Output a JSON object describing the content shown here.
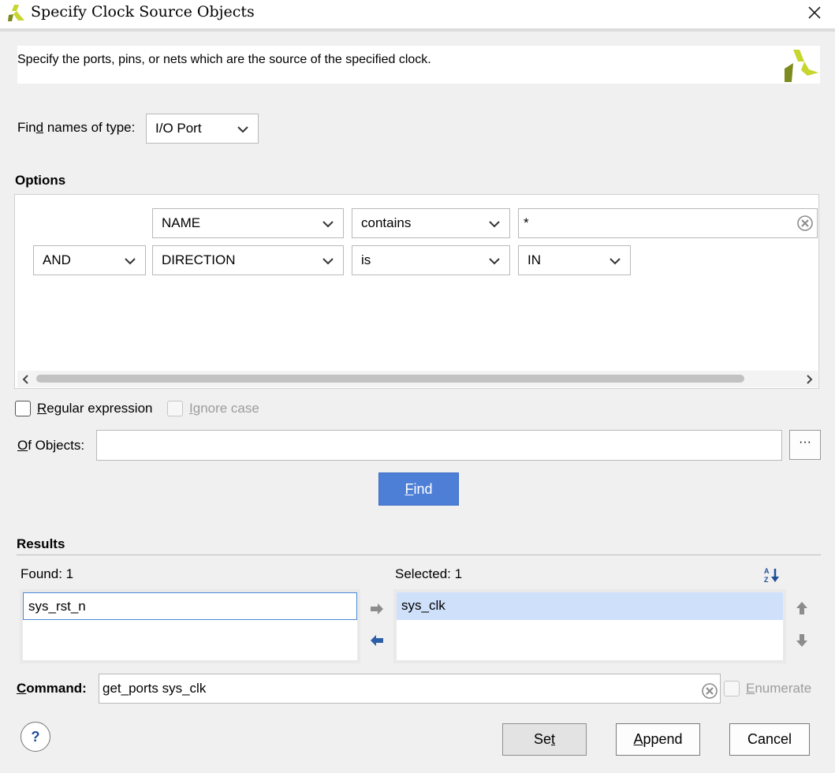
{
  "window": {
    "title": "Specify Clock Source Objects"
  },
  "banner": {
    "description": "Specify the ports, pins, or nets which are the source of the specified clock."
  },
  "find_type": {
    "label_pre": "Fin",
    "label_u": "d",
    "label_post": " names of type:",
    "value": "I/O Port"
  },
  "options": {
    "title": "Options",
    "rows": [
      {
        "logic": "",
        "property": "NAME",
        "operator": "contains",
        "value": "*"
      },
      {
        "logic": "AND",
        "property": "DIRECTION",
        "operator": "is",
        "value": "IN"
      }
    ]
  },
  "regex": {
    "label_u": "R",
    "label_rest": "egular expression",
    "checked": false
  },
  "ignore_case": {
    "label_u": "I",
    "label_rest": "gnore case",
    "checked": false,
    "disabled": true
  },
  "of_objects": {
    "label_u": "O",
    "label_rest": "f Objects:",
    "value": "",
    "browse_label": "···"
  },
  "find_button": {
    "label_u": "F",
    "label_rest": "ind"
  },
  "results": {
    "title": "Results",
    "found_label": "Found: 1",
    "selected_label": "Selected: 1",
    "found_items": [
      "sys_rst_n"
    ],
    "selected_items": [
      "sys_clk"
    ]
  },
  "command": {
    "label_u": "C",
    "label_rest": "ommand:",
    "value": "get_ports sys_clk"
  },
  "enumerate": {
    "label_u": "E",
    "label_rest": "numerate",
    "checked": false,
    "disabled": true
  },
  "buttons": {
    "help": "?",
    "set_pre": "Se",
    "set_u": "t",
    "append_u": "A",
    "append_rest": "ppend",
    "cancel": "Cancel"
  },
  "colors": {
    "accent": "#4e7fd7",
    "selection": "#cfe0fb",
    "logo_light": "#c7d62f",
    "logo_dark": "#7d8a1d"
  }
}
